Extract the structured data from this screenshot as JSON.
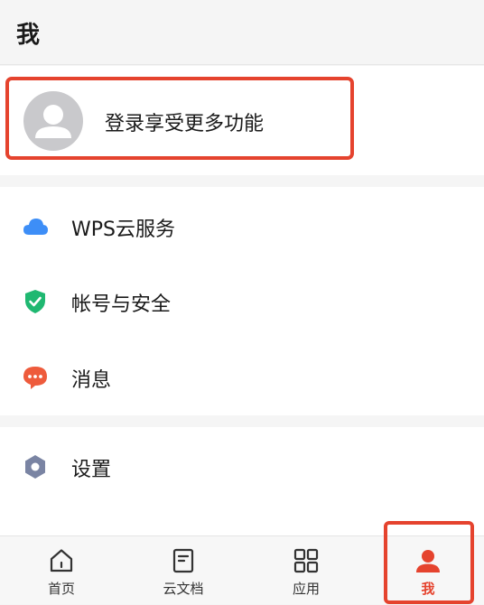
{
  "header": {
    "title": "我"
  },
  "login": {
    "prompt": "登录享受更多功能",
    "avatar_icon": "default-avatar-icon"
  },
  "menu": {
    "group1": [
      {
        "label": "WPS云服务",
        "icon": "cloud-icon",
        "color": "#3d8ef7"
      },
      {
        "label": "帐号与安全",
        "icon": "shield-check-icon",
        "color": "#1fb871"
      },
      {
        "label": "消息",
        "icon": "chat-bubble-icon",
        "color": "#ee5b3c"
      }
    ],
    "group2": [
      {
        "label": "设置",
        "icon": "settings-hexagon-icon",
        "color": "#7a84a3"
      }
    ]
  },
  "tabbar": {
    "tabs": [
      {
        "label": "首页",
        "icon": "home-icon"
      },
      {
        "label": "云文档",
        "icon": "document-icon"
      },
      {
        "label": "应用",
        "icon": "apps-grid-icon"
      },
      {
        "label": "我",
        "icon": "person-icon",
        "active": true
      }
    ],
    "active_color": "#e5432e"
  }
}
